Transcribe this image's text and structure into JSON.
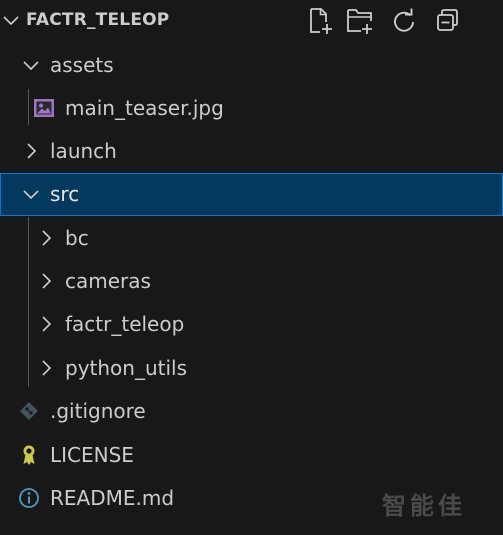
{
  "explorer": {
    "section_title": "FACTR_TELEOP",
    "actions": [
      {
        "name": "new-file-icon",
        "label": "New File"
      },
      {
        "name": "new-folder-icon",
        "label": "New Folder"
      },
      {
        "name": "refresh-icon",
        "label": "Refresh Explorer"
      },
      {
        "name": "collapse-all-icon",
        "label": "Collapse Folders in Explorer"
      }
    ],
    "tree": [
      {
        "label": "assets",
        "type": "folder",
        "expanded": true,
        "depth": 1
      },
      {
        "label": "main_teaser.jpg",
        "type": "image-file",
        "icon": "image-icon",
        "depth": 2
      },
      {
        "label": "launch",
        "type": "folder",
        "expanded": false,
        "depth": 1
      },
      {
        "label": "src",
        "type": "folder",
        "expanded": true,
        "selected": true,
        "depth": 1
      },
      {
        "label": "bc",
        "type": "folder",
        "expanded": false,
        "depth": 2
      },
      {
        "label": "cameras",
        "type": "folder",
        "expanded": false,
        "depth": 2
      },
      {
        "label": "factr_teleop",
        "type": "folder",
        "expanded": false,
        "depth": 2
      },
      {
        "label": "python_utils",
        "type": "folder",
        "expanded": false,
        "depth": 2
      },
      {
        "label": ".gitignore",
        "type": "file",
        "icon": "git-icon",
        "depth": 1
      },
      {
        "label": "LICENSE",
        "type": "file",
        "icon": "license-icon",
        "depth": 1
      },
      {
        "label": "README.md",
        "type": "file",
        "icon": "info-icon",
        "depth": 1
      }
    ]
  },
  "colors": {
    "background": "#181818",
    "text": "#cccccc",
    "selection_bg": "#04395e",
    "selection_border": "#0078d4",
    "image_icon": "#a074c4",
    "git_icon": "#41535b",
    "license_icon": "#cbcb41",
    "info_icon": "#519aba"
  },
  "watermark": "智能佳"
}
